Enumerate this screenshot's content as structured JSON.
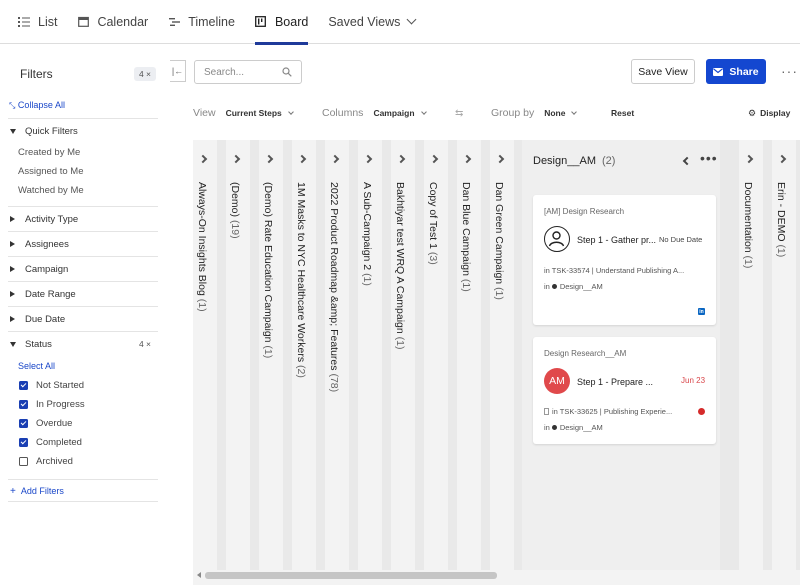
{
  "nav": {
    "tabs": [
      {
        "label": "List",
        "icon": "list-icon"
      },
      {
        "label": "Calendar",
        "icon": "calendar-icon"
      },
      {
        "label": "Timeline",
        "icon": "timeline-icon"
      },
      {
        "label": "Board",
        "icon": "board-icon",
        "active": true
      },
      {
        "label": "Saved Views",
        "icon": "chevron-down-icon"
      }
    ]
  },
  "sidebar": {
    "title": "Filters",
    "count": "4",
    "collapse_all": "Collapse All",
    "quick_filters": {
      "label": "Quick Filters",
      "items": [
        "Created by Me",
        "Assigned to Me",
        "Watched by Me"
      ]
    },
    "sections": [
      "Activity Type",
      "Assignees",
      "Campaign",
      "Date Range",
      "Due Date"
    ],
    "status": {
      "label": "Status",
      "count": "4",
      "select_all": "Select All",
      "options": [
        {
          "label": "Not Started",
          "checked": true
        },
        {
          "label": "In Progress",
          "checked": true
        },
        {
          "label": "Overdue",
          "checked": true
        },
        {
          "label": "Completed",
          "checked": true
        },
        {
          "label": "Archived",
          "checked": false
        }
      ]
    },
    "add_filters": "Add Filters"
  },
  "toolbar": {
    "search_placeholder": "Search...",
    "save_view": "Save View",
    "share": "Share"
  },
  "viewbar": {
    "view_label": "View",
    "view_value": "Current Steps",
    "columns_label": "Columns",
    "columns_value": "Campaign",
    "group_label": "Group by",
    "group_value": "None",
    "reset": "Reset",
    "display": "Display"
  },
  "board": {
    "columns_left": [
      {
        "name": "Always-On Insights Blog",
        "count": "(1)"
      },
      {
        "name": "(Demo)",
        "count": "(19)"
      },
      {
        "name": "(Demo) Rate Education Campaign",
        "count": "(1)"
      },
      {
        "name": "1M Masks to NYC Healthcare Workers",
        "count": "(2)"
      },
      {
        "name": "2022 Product Roadmap &amp; Features",
        "count": "(78)"
      },
      {
        "name": "A Sub-Campaign 2",
        "count": "(1)"
      },
      {
        "name": "Bakhtiyar test WRQ A Campaign",
        "count": "(1)"
      },
      {
        "name": "Copy of Test 1",
        "count": "(3)"
      },
      {
        "name": "Dan Blue Campaign",
        "count": "(1)"
      },
      {
        "name": "Dan Green Campaign",
        "count": "(1)"
      }
    ],
    "expanded": {
      "name": "Design__AM",
      "count": "(2)",
      "cards": [
        {
          "category": "[AM] Design Research",
          "step": "Step 1 - Gather pr...",
          "due": "No Due Date",
          "task": "in TSK-33574 | Understand Publishing A...",
          "campaign": "Design__AM",
          "avatar": "person-outline"
        },
        {
          "category": "Design Research__AM",
          "step": "Step 1 - Prepare ...",
          "due": "Jun 23",
          "task": "in TSK-33625 | Publishing Experie...",
          "campaign": "Design__AM",
          "avatar": "AM"
        }
      ]
    },
    "columns_right": [
      {
        "name": "Documentation",
        "count": "(1)"
      },
      {
        "name": "Erin - DEMO",
        "count": "(1)"
      }
    ]
  },
  "colors": {
    "accent": "#1447d0",
    "overdue": "#e0494b",
    "linkedin": "#0a66c2"
  }
}
